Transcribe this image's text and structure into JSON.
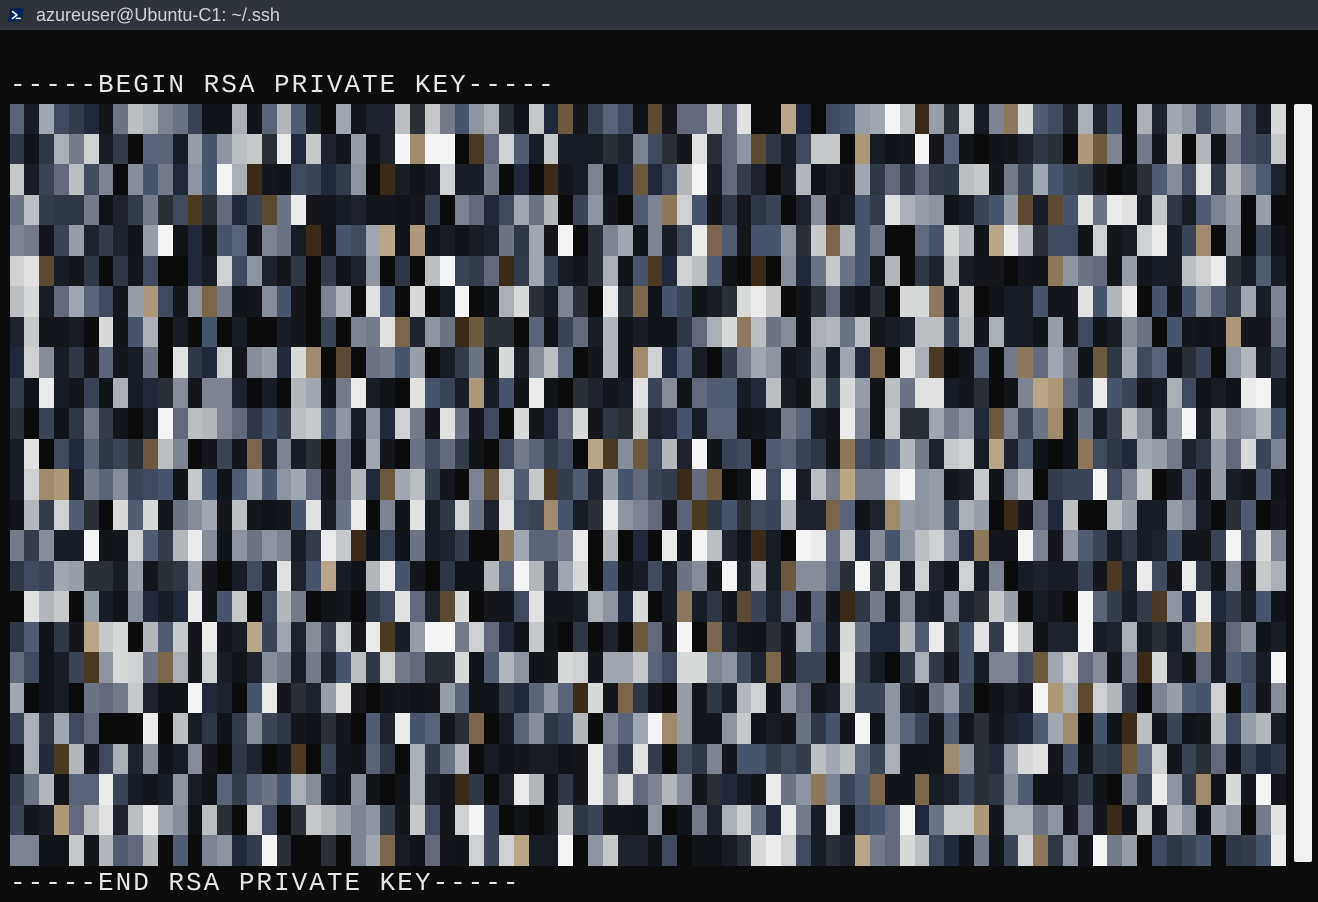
{
  "window": {
    "title": "azureuser@Ubuntu-C1: ~/.ssh"
  },
  "terminal": {
    "begin_line": "-----BEGIN RSA PRIVATE KEY-----",
    "end_line": "-----END RSA PRIVATE KEY-----",
    "body_redacted": true,
    "body_note": "25 lines of base64 key material, pixelated / redacted in source image"
  },
  "mosaic": {
    "cols": 86,
    "rows": 25,
    "palette": [
      "#0b0b0c",
      "#101318",
      "#14161c",
      "#181c24",
      "#1d222c",
      "#20283a",
      "#2a2f36",
      "#2f3644",
      "#343c4a",
      "#3a4454",
      "#404a5c",
      "#48546a",
      "#525c70",
      "#5a6476",
      "#63687a",
      "#6c7382",
      "#747a88",
      "#7d8390",
      "#868c98",
      "#8f95a0",
      "#989ea8",
      "#a1a7b0",
      "#aaafb6",
      "#b3b7bc",
      "#bcbfc2",
      "#c6c8ca",
      "#cfd0d1",
      "#d8d9d9",
      "#e1e1e1",
      "#ebebeb",
      "#f4f4f4",
      "#3a2a1a",
      "#4a3a24",
      "#5a4a34",
      "#6b5a40",
      "#7a664c",
      "#8c785c",
      "#9e8a6c",
      "#ac987a",
      "#b8a688"
    ]
  }
}
